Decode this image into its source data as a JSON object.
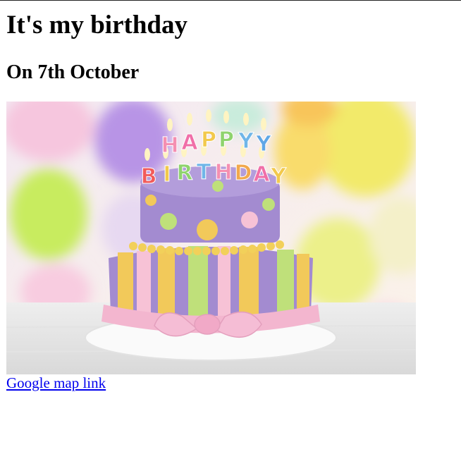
{
  "page": {
    "title": "It's my birthday",
    "subtitle": "On 7th October",
    "link_text": "Google map link"
  },
  "image": {
    "subject": "birthday-cake-photo",
    "candle_letters": [
      "H",
      "A",
      "P",
      "P",
      "Y",
      "B",
      "I",
      "R",
      "T",
      "H",
      "D",
      "A",
      "Y"
    ]
  },
  "colors": {
    "link": "#0000ee",
    "cake_top": "#a38bd0",
    "ribbon": "#f3b6cf",
    "stripe_yellow": "#f2c95a",
    "stripe_green": "#bfe07a"
  }
}
